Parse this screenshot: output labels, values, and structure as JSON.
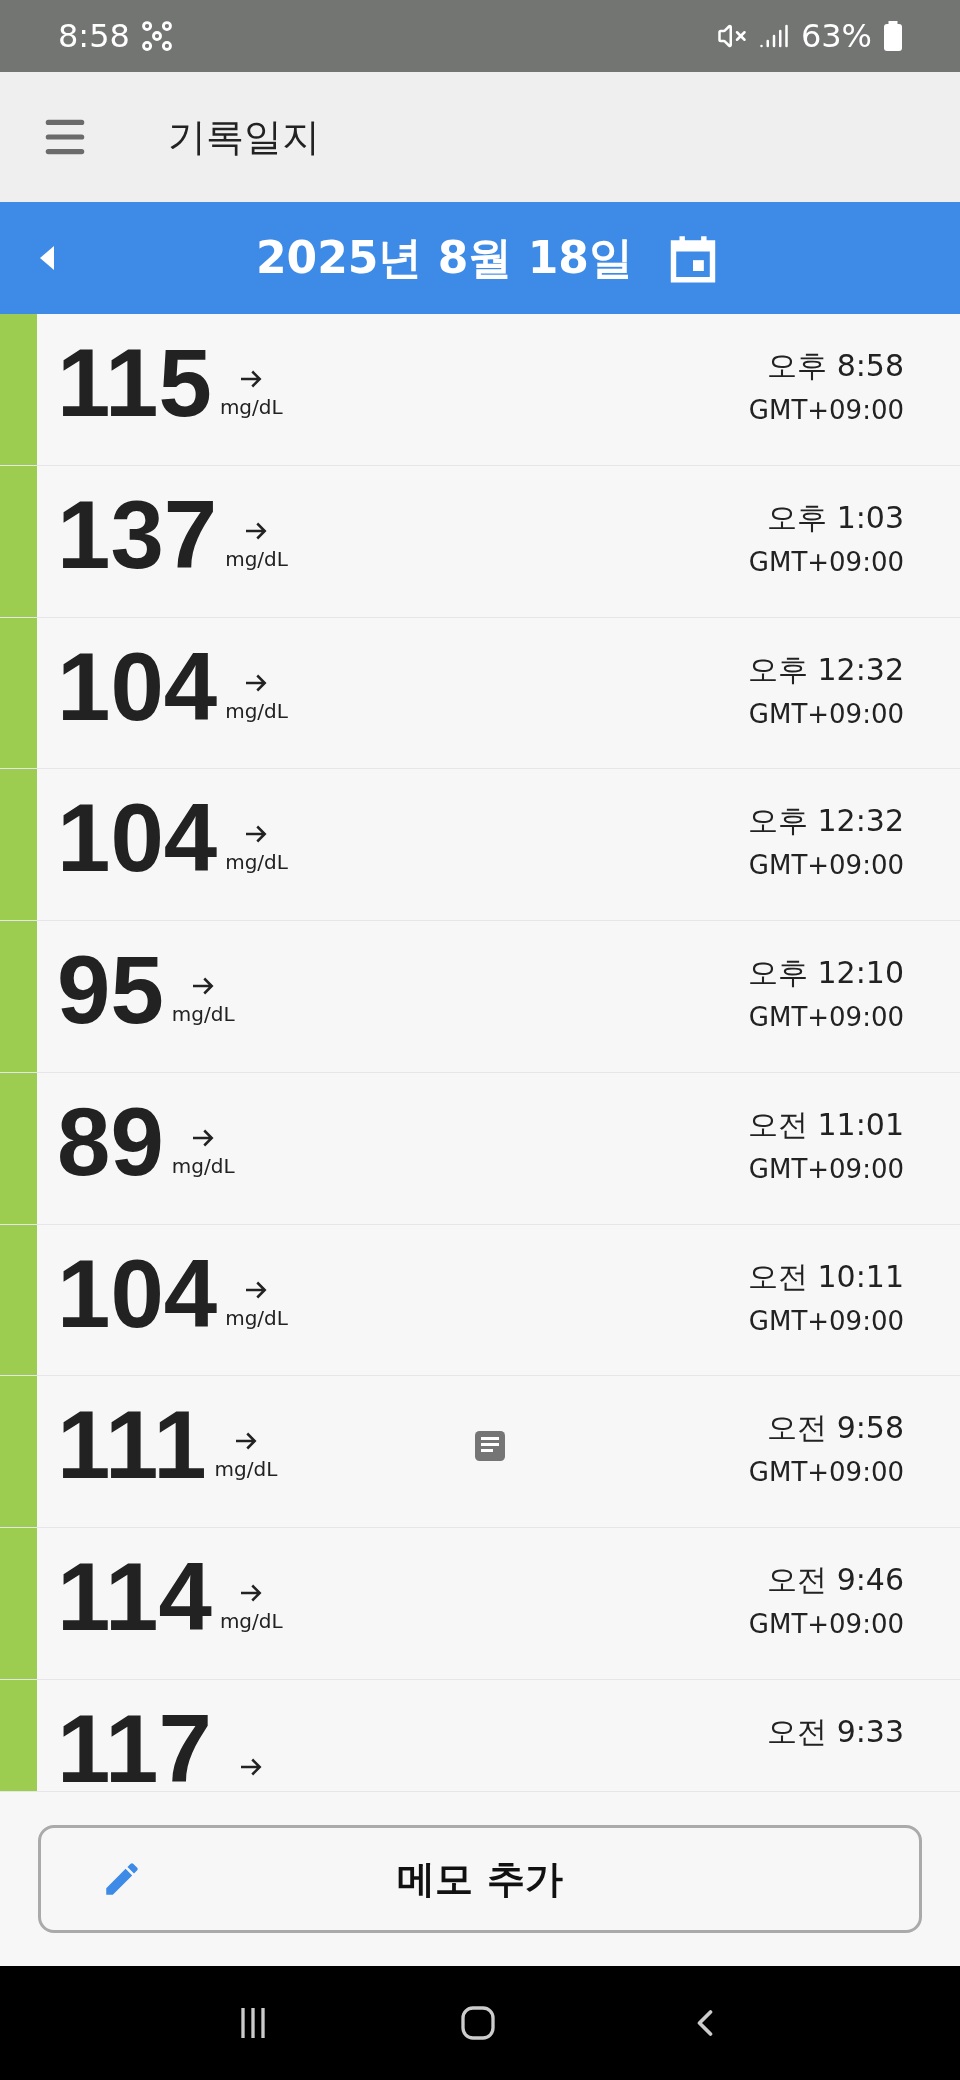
{
  "status_bar": {
    "time": "8:58",
    "battery": "63%"
  },
  "app_bar": {
    "title": "기록일지"
  },
  "date_bar": {
    "date": "2025년 8월 18일"
  },
  "readings": [
    {
      "kind": "full",
      "value": "115",
      "unit": "mg/dL",
      "time": "오후 8:58",
      "timezone": "GMT+09:00",
      "memo": false,
      "color": "#9ccc50"
    },
    {
      "kind": "full",
      "value": "137",
      "unit": "mg/dL",
      "time": "오후 1:03",
      "timezone": "GMT+09:00",
      "memo": false,
      "color": "#9ccc50"
    },
    {
      "kind": "full",
      "value": "104",
      "unit": "mg/dL",
      "time": "오후 12:32",
      "timezone": "GMT+09:00",
      "memo": false,
      "color": "#9ccc50"
    },
    {
      "kind": "full",
      "value": "104",
      "unit": "mg/dL",
      "time": "오후 12:32",
      "timezone": "GMT+09:00",
      "memo": false,
      "color": "#9ccc50"
    },
    {
      "kind": "full",
      "value": "95",
      "unit": "mg/dL",
      "time": "오후 12:10",
      "timezone": "GMT+09:00",
      "memo": false,
      "color": "#9ccc50"
    },
    {
      "kind": "full",
      "value": "89",
      "unit": "mg/dL",
      "time": "오전 11:01",
      "timezone": "GMT+09:00",
      "memo": false,
      "color": "#9ccc50"
    },
    {
      "kind": "full",
      "value": "104",
      "unit": "mg/dL",
      "time": "오전 10:11",
      "timezone": "GMT+09:00",
      "memo": false,
      "color": "#9ccc50"
    },
    {
      "kind": "full",
      "value": "111",
      "unit": "mg/dL",
      "time": "오전 9:58",
      "timezone": "GMT+09:00",
      "memo": true,
      "color": "#9ccc50"
    },
    {
      "kind": "full",
      "value": "114",
      "unit": "mg/dL",
      "time": "오전 9:46",
      "timezone": "GMT+09:00",
      "memo": false,
      "color": "#9ccc50"
    },
    {
      "kind": "partial",
      "value": "117",
      "time": "오전 9:33",
      "memo": false,
      "color": "#9ccc50"
    }
  ],
  "memo_button": {
    "label": "메모 추가"
  }
}
